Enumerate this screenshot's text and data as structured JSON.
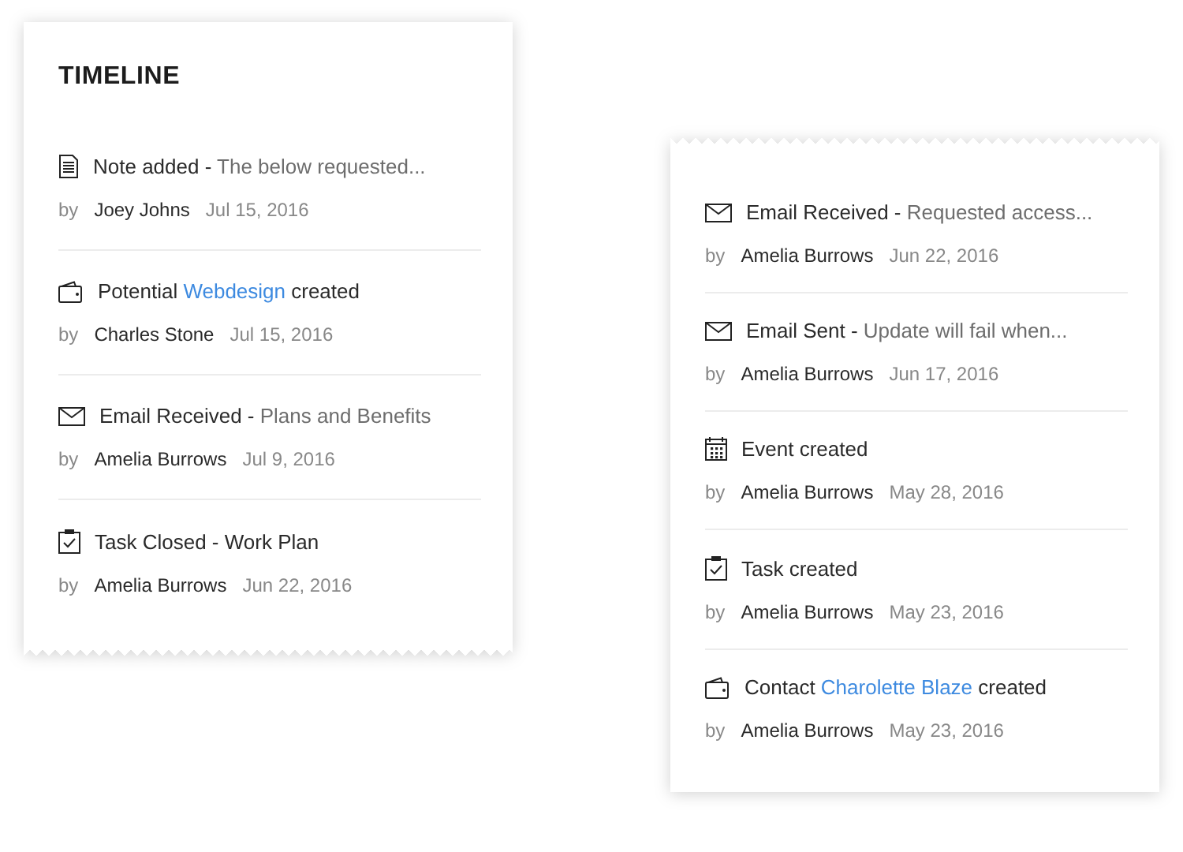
{
  "cards": [
    {
      "title": "TIMELINE",
      "kind": "torn-bottom",
      "entries": [
        {
          "kind": "note",
          "parts": [
            {
              "kind": "plain",
              "text": "Note added - "
            },
            {
              "kind": "muted",
              "text": "The below requested..."
            }
          ],
          "by": "by",
          "author": "Joey Johns",
          "date": "Jul 15, 2016"
        },
        {
          "kind": "wallet",
          "parts": [
            {
              "kind": "plain",
              "text": "Potential "
            },
            {
              "kind": "link",
              "text": "Webdesign"
            },
            {
              "kind": "plain",
              "text": " created"
            }
          ],
          "by": "by",
          "author": "Charles Stone",
          "date": "Jul 15, 2016"
        },
        {
          "kind": "mail",
          "parts": [
            {
              "kind": "plain",
              "text": "Email Received - "
            },
            {
              "kind": "muted",
              "text": "Plans and Benefits"
            }
          ],
          "by": "by",
          "author": "Amelia Burrows",
          "date": "Jul 9, 2016"
        },
        {
          "kind": "task",
          "parts": [
            {
              "kind": "plain",
              "text": "Task Closed - Work Plan"
            }
          ],
          "by": "by",
          "author": "Amelia Burrows",
          "date": "Jun 22, 2016"
        }
      ]
    },
    {
      "kind": "torn-top",
      "entries": [
        {
          "kind": "mail",
          "parts": [
            {
              "kind": "plain",
              "text": "Email Received - "
            },
            {
              "kind": "muted",
              "text": "Requested access..."
            }
          ],
          "by": "by",
          "author": "Amelia Burrows",
          "date": "Jun 22, 2016"
        },
        {
          "kind": "mail",
          "parts": [
            {
              "kind": "plain",
              "text": "Email Sent - "
            },
            {
              "kind": "muted",
              "text": "Update will fail when..."
            }
          ],
          "by": "by",
          "author": "Amelia Burrows",
          "date": "Jun 17, 2016"
        },
        {
          "kind": "calendar",
          "parts": [
            {
              "kind": "plain",
              "text": "Event created"
            }
          ],
          "by": "by",
          "author": "Amelia Burrows",
          "date": "May 28, 2016"
        },
        {
          "kind": "task",
          "parts": [
            {
              "kind": "plain",
              "text": "Task created"
            }
          ],
          "by": "by",
          "author": "Amelia Burrows",
          "date": "May 23, 2016"
        },
        {
          "kind": "wallet",
          "parts": [
            {
              "kind": "plain",
              "text": "Contact "
            },
            {
              "kind": "link",
              "text": "Charolette Blaze"
            },
            {
              "kind": "plain",
              "text": " created"
            }
          ],
          "by": "by",
          "author": "Amelia Burrows",
          "date": "May 23, 2016"
        }
      ]
    }
  ]
}
